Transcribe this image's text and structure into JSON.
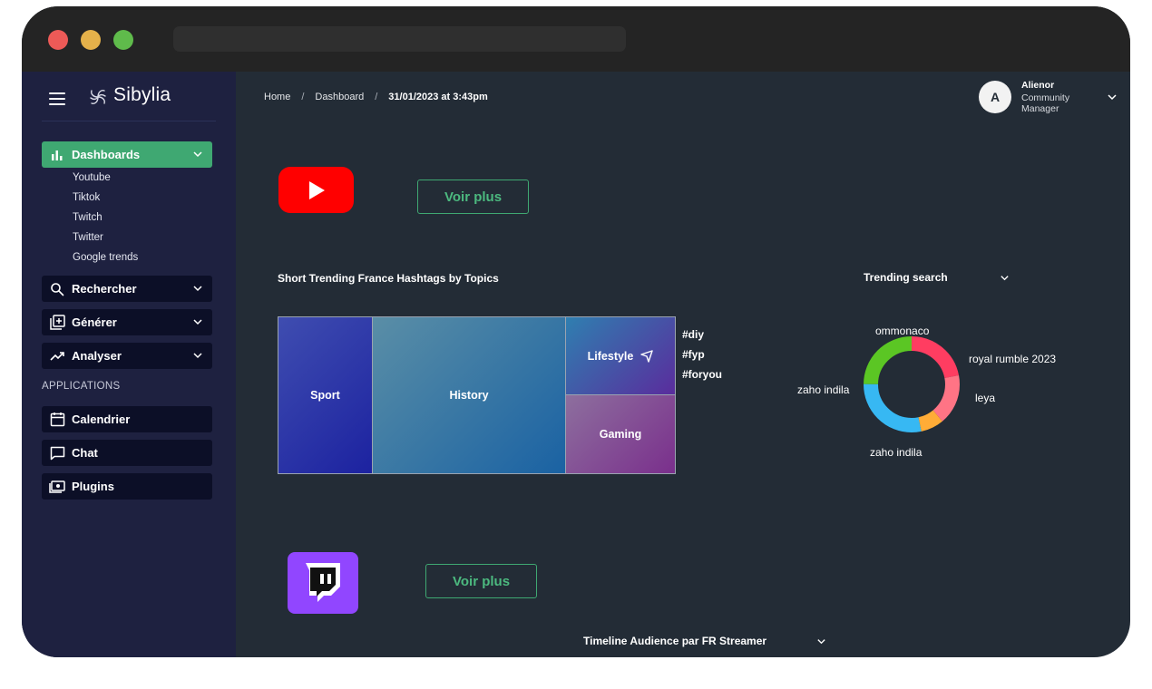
{
  "app": {
    "name": "Sibylia"
  },
  "sidebar": {
    "items": [
      {
        "label": "Dashboards",
        "active": true
      },
      {
        "label": "Rechercher"
      },
      {
        "label": "Générer"
      },
      {
        "label": "Analyser"
      }
    ],
    "submenu": [
      "Youtube",
      "Tiktok",
      "Twitch",
      "Twitter",
      "Google trends"
    ],
    "applications_label": "APPLICATIONS",
    "apps": [
      {
        "label": "Calendrier"
      },
      {
        "label": "Chat"
      },
      {
        "label": "Plugins"
      }
    ]
  },
  "breadcrumb": {
    "home": "Home",
    "dashboard": "Dashboard",
    "current": "31/01/2023 at 3:43pm"
  },
  "user": {
    "initial": "A",
    "name": "Alienor",
    "role": "Community Manager"
  },
  "youtube": {
    "button": "Voir plus"
  },
  "treemap": {
    "title": "Short Trending France Hashtags by Topics",
    "tiles": [
      "Sport",
      "History",
      "Lifestyle",
      "Gaming"
    ],
    "hashtags": [
      "#diy",
      "#fyp",
      "#foryou"
    ]
  },
  "trending": {
    "title": "Trending search",
    "labels": [
      "ommonaco",
      "royal rumble 2023",
      "leya",
      "zaho indila",
      "zaho indila"
    ]
  },
  "twitch": {
    "button": "Voir plus",
    "timeline_title": "Timeline Audience par FR Streamer"
  },
  "colors": {
    "accent": "#3fa872",
    "sidebar_bg": "#1e2140",
    "main_bg": "#232c36",
    "youtube": "#ff0000",
    "twitch": "#9146ff"
  }
}
